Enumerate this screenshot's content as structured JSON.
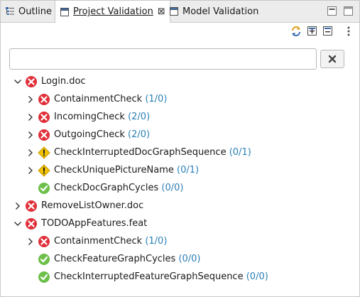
{
  "tabs": [
    {
      "label": "Outline",
      "active": false
    },
    {
      "label": "Project Validation",
      "active": true,
      "close_glyph": "⊠"
    },
    {
      "label": "Model Validation",
      "active": false
    }
  ],
  "toolbar": {
    "icons": [
      "sync-icon",
      "expand-all-icon",
      "collapse-all-icon",
      "view-menu-icon"
    ]
  },
  "search": {
    "value": "",
    "placeholder": ""
  },
  "colors": {
    "error": "#e0303a",
    "warning": "#f2c200",
    "ok": "#6cc04a",
    "count": "#2a7fb8"
  },
  "tree": [
    {
      "label": "Login.doc",
      "count": "",
      "status": "error",
      "level": 0,
      "twisty": "expanded"
    },
    {
      "label": "ContainmentCheck",
      "count": "(1/0)",
      "status": "error",
      "level": 1,
      "twisty": "collapsed"
    },
    {
      "label": "IncomingCheck",
      "count": "(2/0)",
      "status": "error",
      "level": 1,
      "twisty": "collapsed"
    },
    {
      "label": "OutgoingCheck",
      "count": "(2/0)",
      "status": "error",
      "level": 1,
      "twisty": "collapsed"
    },
    {
      "label": "CheckInterruptedDocGraphSequence",
      "count": "(0/1)",
      "status": "warning",
      "level": 1,
      "twisty": "collapsed"
    },
    {
      "label": "CheckUniquePictureName",
      "count": "(0/1)",
      "status": "warning",
      "level": 1,
      "twisty": "collapsed"
    },
    {
      "label": "CheckDocGraphCycles",
      "count": "(0/0)",
      "status": "ok",
      "level": 1,
      "twisty": "none"
    },
    {
      "label": "RemoveListOwner.doc",
      "count": "",
      "status": "error",
      "level": 0,
      "twisty": "collapsed"
    },
    {
      "label": "TODOAppFeatures.feat",
      "count": "",
      "status": "error",
      "level": 0,
      "twisty": "expanded"
    },
    {
      "label": "ContainmentCheck",
      "count": "(1/0)",
      "status": "error",
      "level": 1,
      "twisty": "collapsed"
    },
    {
      "label": "CheckFeatureGraphCycles",
      "count": "(0/0)",
      "status": "ok",
      "level": 1,
      "twisty": "none"
    },
    {
      "label": "CheckInterruptedFeatureGraphSequence",
      "count": "(0/0)",
      "status": "ok",
      "level": 1,
      "twisty": "none"
    }
  ]
}
